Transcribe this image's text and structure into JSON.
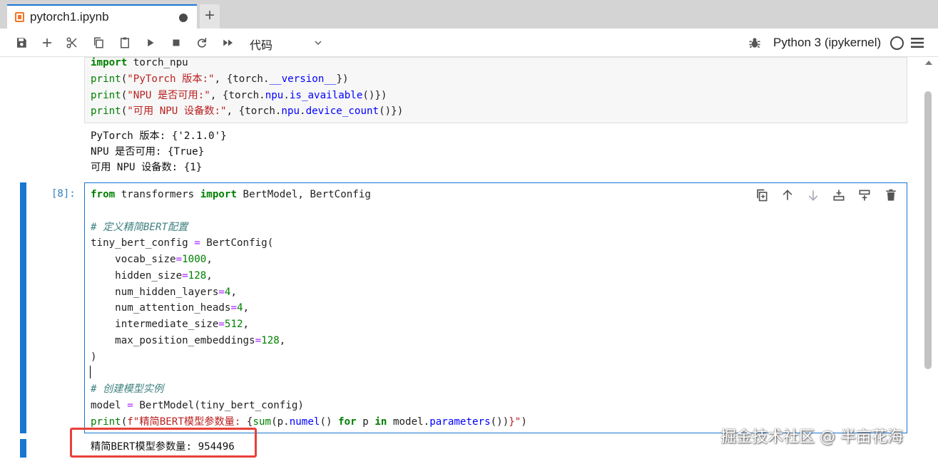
{
  "tab": {
    "title": "pytorch1.ipynb",
    "add_label": "+"
  },
  "toolbar": {
    "cell_type": "代码",
    "kernel_name": "Python 3 (ipykernel)"
  },
  "cells": [
    {
      "code_lines": [
        [
          {
            "t": "import",
            "c": "kw"
          },
          {
            "t": " torch_npu",
            "c": ""
          }
        ],
        [
          {
            "t": "print",
            "c": "fn"
          },
          {
            "t": "(",
            "c": ""
          },
          {
            "t": "\"PyTorch 版本:\"",
            "c": "str"
          },
          {
            "t": ", {torch.",
            "c": ""
          },
          {
            "t": "__version__",
            "c": "attr"
          },
          {
            "t": "})",
            "c": ""
          }
        ],
        [
          {
            "t": "print",
            "c": "fn"
          },
          {
            "t": "(",
            "c": ""
          },
          {
            "t": "\"NPU 是否可用:\"",
            "c": "str"
          },
          {
            "t": ", {torch.",
            "c": ""
          },
          {
            "t": "npu",
            "c": "attr"
          },
          {
            "t": ".",
            "c": ""
          },
          {
            "t": "is_available",
            "c": "attr"
          },
          {
            "t": "()})",
            "c": ""
          }
        ],
        [
          {
            "t": "print",
            "c": "fn"
          },
          {
            "t": "(",
            "c": ""
          },
          {
            "t": "\"可用 NPU 设备数:\"",
            "c": "str"
          },
          {
            "t": ", {torch.",
            "c": ""
          },
          {
            "t": "npu",
            "c": "attr"
          },
          {
            "t": ".",
            "c": ""
          },
          {
            "t": "device_count",
            "c": "attr"
          },
          {
            "t": "()})",
            "c": ""
          }
        ]
      ],
      "output": [
        "PyTorch 版本: {'2.1.0'}",
        "NPU 是否可用: {True}",
        "可用 NPU 设备数: {1}"
      ]
    },
    {
      "prompt": "[8]:",
      "code_lines": [
        [
          {
            "t": "from",
            "c": "kw"
          },
          {
            "t": " transformers ",
            "c": ""
          },
          {
            "t": "import",
            "c": "kw"
          },
          {
            "t": " BertModel, BertConfig",
            "c": ""
          }
        ],
        [],
        [
          {
            "t": "# 定义精简BERT配置",
            "c": "cm"
          }
        ],
        [
          {
            "t": "tiny_bert_config ",
            "c": ""
          },
          {
            "t": "=",
            "c": "op"
          },
          {
            "t": " BertConfig(",
            "c": ""
          }
        ],
        [
          {
            "t": "    vocab_size",
            "c": ""
          },
          {
            "t": "=",
            "c": "op"
          },
          {
            "t": "1000",
            "c": "num"
          },
          {
            "t": ",",
            "c": ""
          }
        ],
        [
          {
            "t": "    hidden_size",
            "c": ""
          },
          {
            "t": "=",
            "c": "op"
          },
          {
            "t": "128",
            "c": "num"
          },
          {
            "t": ",",
            "c": ""
          }
        ],
        [
          {
            "t": "    num_hidden_layers",
            "c": ""
          },
          {
            "t": "=",
            "c": "op"
          },
          {
            "t": "4",
            "c": "num"
          },
          {
            "t": ",",
            "c": ""
          }
        ],
        [
          {
            "t": "    num_attention_heads",
            "c": ""
          },
          {
            "t": "=",
            "c": "op"
          },
          {
            "t": "4",
            "c": "num"
          },
          {
            "t": ",",
            "c": ""
          }
        ],
        [
          {
            "t": "    intermediate_size",
            "c": ""
          },
          {
            "t": "=",
            "c": "op"
          },
          {
            "t": "512",
            "c": "num"
          },
          {
            "t": ",",
            "c": ""
          }
        ],
        [
          {
            "t": "    max_position_embeddings",
            "c": ""
          },
          {
            "t": "=",
            "c": "op"
          },
          {
            "t": "128",
            "c": "num"
          },
          {
            "t": ",",
            "c": ""
          }
        ],
        [
          {
            "t": ")",
            "c": ""
          }
        ],
        [],
        [
          {
            "t": "# 创建模型实例",
            "c": "cm"
          }
        ],
        [
          {
            "t": "model ",
            "c": ""
          },
          {
            "t": "=",
            "c": "op"
          },
          {
            "t": " BertModel(tiny_bert_config)",
            "c": ""
          }
        ],
        [
          {
            "t": "print",
            "c": "fn"
          },
          {
            "t": "(",
            "c": ""
          },
          {
            "t": "f\"精简BERT模型参数量: ",
            "c": "str"
          },
          {
            "t": "{",
            "c": ""
          },
          {
            "t": "sum",
            "c": "fn"
          },
          {
            "t": "(p.",
            "c": ""
          },
          {
            "t": "numel",
            "c": "attr"
          },
          {
            "t": "() ",
            "c": ""
          },
          {
            "t": "for",
            "c": "kw"
          },
          {
            "t": " p ",
            "c": ""
          },
          {
            "t": "in",
            "c": "kw"
          },
          {
            "t": " model.",
            "c": ""
          },
          {
            "t": "parameters",
            "c": "attr"
          },
          {
            "t": "())",
            "c": ""
          },
          {
            "t": "}\"",
            "c": "str"
          },
          {
            "t": ")",
            "c": ""
          }
        ]
      ],
      "output": [
        "精简BERT模型参数量: 954496"
      ]
    }
  ],
  "watermark": "掘金技术社区 @ 半亩花海",
  "icons": {
    "toolbar": [
      "save-icon",
      "add-icon",
      "cut-icon",
      "copy-icon",
      "paste-icon",
      "run-icon",
      "stop-icon",
      "restart-icon",
      "run-all-icon"
    ],
    "cell_tools": [
      "duplicate-icon",
      "move-up-icon",
      "move-down-icon",
      "insert-below-icon",
      "insert-above-icon",
      "delete-icon"
    ]
  }
}
